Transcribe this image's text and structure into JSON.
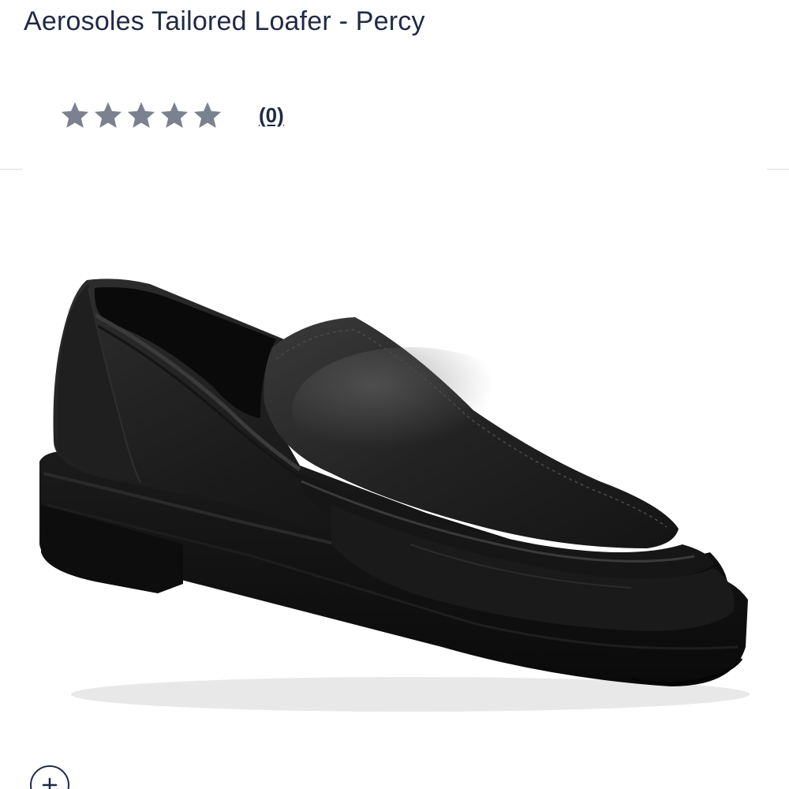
{
  "product": {
    "title": "Aerosoles Tailored Loafer - Percy",
    "image_icon": "black-loafer-shoe-image"
  },
  "rating": {
    "stars_filled": 0,
    "stars_total": 5,
    "review_count_label": "(0)",
    "star_color": "#7c8190"
  },
  "zoom": {
    "icon": "plus-icon"
  },
  "colors": {
    "title": "#1f2a44",
    "divider": "#d9dbe0"
  }
}
